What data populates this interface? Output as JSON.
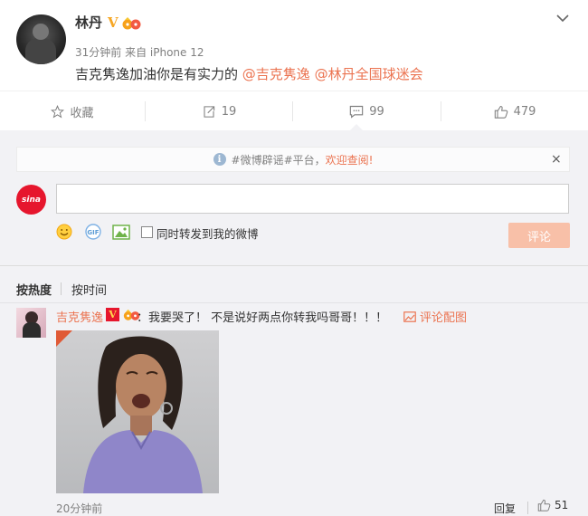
{
  "post": {
    "username": "林丹",
    "vip_mark": "V",
    "meta": "31分钟前 来自 iPhone 12",
    "text_prefix": "吉克隽逸加油你是有实力的 ",
    "mention_1": "@吉克隽逸",
    "mention_2": "@林丹全国球迷会"
  },
  "actions": {
    "favorite_label": "收藏",
    "repost_count": "19",
    "comment_count": "99",
    "like_count": "479"
  },
  "notice": {
    "info_glyph": "i",
    "text": "#微博辟谣#平台，",
    "link": "欢迎查阅!",
    "close": "×"
  },
  "composer": {
    "logo_text": "sina",
    "input_value": "",
    "repost_checkbox_label": "同时转发到我的微博",
    "submit_label": "评论",
    "checked": false
  },
  "sort": {
    "hot": "按热度",
    "time": "按时间"
  },
  "comment": {
    "username": "吉克隽逸",
    "vip_mark": "V",
    "text": "：我要哭了！ 不是说好两点你转我吗哥哥！！！",
    "pic_link": "评论配图",
    "time": "20分钟前",
    "reply": "回复",
    "likes": "51"
  },
  "colors": {
    "accent": "#eb7350",
    "vip_gold": "#f6a623",
    "sina_red": "#e6162d",
    "panel_bg": "#f2f2f5",
    "submit_disabled": "#f8c0a8"
  }
}
